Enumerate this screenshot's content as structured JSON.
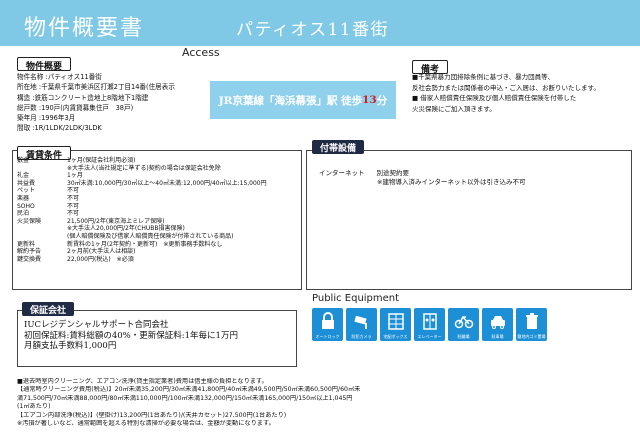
{
  "header": {
    "title": "物件概要書",
    "property_name": "パティオス11番街"
  },
  "access_label": "Access",
  "station": {
    "line": "JR京葉線「海浜幕張」駅 徒歩",
    "minutes": "13",
    "unit": "分"
  },
  "overview": {
    "title": "物件概要",
    "lines": [
      "物件名称 :パティオス11番街",
      "所在地 :千葉県千葉市美浜区打瀬2丁目14番(住居表示",
      "構造 :鉄筋コンクリート造地上8階地下1階建",
      "総戸数 :190戸(内賃貸募集住戸　38戸)",
      "築年月 :1996年3月",
      "間取 :1R/1LDK/2LDK/3LDK"
    ]
  },
  "remarks": {
    "title": "備考",
    "lines": [
      "■千葉県暴力団排除条例に基づき、暴力団員等、",
      "反社会勢力または関係者の申込・ご入居は、お断りいたします。",
      "■ 借家人賠償責任保険及び個人賠償責任保険を付帯した",
      "火災保険にご加入頂きます。"
    ]
  },
  "rent": {
    "title": "賃貸条件",
    "rows": [
      {
        "label": "敷金",
        "value": "1ヶ月(保証会社利用必須)"
      },
      {
        "label": "",
        "value": "※大手法人(当社規定に準ずる)契約の場合は保証会社免除"
      },
      {
        "label": "礼金",
        "value": "1ヶ月"
      },
      {
        "label": "共益費",
        "value": "30㎡未満:10,000円/30㎡以上～40㎡未満:12,000円/40㎡以上:15,000円"
      },
      {
        "label": "ペット",
        "value": "不可"
      },
      {
        "label": "楽器",
        "value": "不可"
      },
      {
        "label": "SOHO",
        "value": "不可"
      },
      {
        "label": "民泊",
        "value": "不可"
      },
      {
        "label": "火災保険",
        "value": "21,500円/2年(東京海上ミレア保険)"
      },
      {
        "label": "",
        "value": "※大手法人20,000円/2年(CHUBB損害保険)"
      },
      {
        "label": "",
        "value": "(個人賠償保険及び借家人賠償責任保険が付帯されている商品)"
      },
      {
        "label": "更新料",
        "value": "新賃料の1ヶ月(2年契約・更新可)　※更新事務手数料なし"
      },
      {
        "label": "解約予告",
        "value": "2ヶ月前(大手法人は相談)"
      },
      {
        "label": "鍵交換費",
        "value": "22,000円(税込)　※必須"
      }
    ]
  },
  "facilities": {
    "title": "付帯設備",
    "internet_label": "インターネット",
    "internet_value": "別途契約要",
    "note": "※建物導入済みインターネット以外は引き込み不可"
  },
  "guarantor": {
    "title": "保証会社",
    "lines": [
      "IUCレジデンシャルサポート合同会社",
      "初回保証料:賃料総額の40%・更新保証料:1年毎に1万円",
      "月額支払手数料1,000円"
    ]
  },
  "public_equipment": {
    "title": "Public Equipment",
    "icons": [
      {
        "name": "auto-lock-icon",
        "label": "オートロック"
      },
      {
        "name": "security-camera-icon",
        "label": "防犯カメラ"
      },
      {
        "name": "delivery-box-icon",
        "label": "宅配ボックス"
      },
      {
        "name": "elevator-icon",
        "label": "エレベーター"
      },
      {
        "name": "bicycle-parking-icon",
        "label": "駐輪場"
      },
      {
        "name": "parking-icon",
        "label": "駐車場"
      },
      {
        "name": "garbage-icon",
        "label": "敷地内ゴミ置場"
      }
    ]
  },
  "footer": {
    "lines": [
      "■退去時室内クリーニング、エアコン洗浄(貸主指定業者)費用は借主様の負担となります。",
      "【通常時クリーニング費用(税込)】20㎡未満35,200円/30㎡未満41,800円/40㎡未満49,500円/50㎡未満60,500円/60㎡未",
      "満71,500円/70㎡未満88,000円/80㎡未満110,000円/100㎡未満132,000円/150㎡未満165,000円/150㎡以上1,045円",
      "(1㎡あたり)",
      "【エアコン内部洗浄(税込)】(壁掛け)13,200円(1台あたり)/(天井カセット)27,500円(1台あたり)",
      "※汚損が著しいなど、通常範囲を超える特別な清掃が必要な場合は、金額が変動になります。"
    ]
  }
}
